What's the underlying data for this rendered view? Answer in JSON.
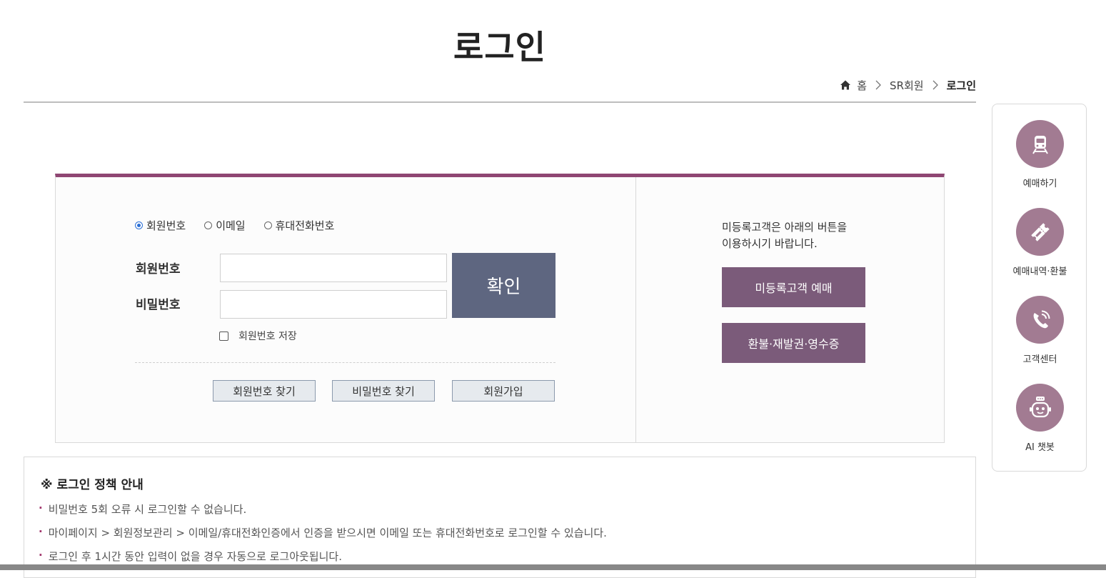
{
  "page": {
    "title": "로그인"
  },
  "breadcrumb": {
    "home": "홈",
    "parent": "SR회원",
    "current": "로그인"
  },
  "login": {
    "options": [
      {
        "label": "회원번호",
        "checked": true
      },
      {
        "label": "이메일",
        "checked": false
      },
      {
        "label": "휴대전화번호",
        "checked": false
      }
    ],
    "id_label": "회원번호",
    "pw_label": "비밀번호",
    "id_value": "",
    "pw_value": "",
    "confirm_label": "확인",
    "save_label": "회원번호 저장",
    "save_checked": false,
    "find_id_label": "회원번호 찾기",
    "find_pw_label": "비밀번호 찾기",
    "signup_label": "회원가입"
  },
  "guest": {
    "text_line1": "미등록고객은 아래의 버튼을",
    "text_line2": "이용하시기 바랍니다.",
    "book_label": "미등록고객 예매",
    "refund_label": "환불·재발권·영수증"
  },
  "policy": {
    "title": "※ 로그인 정책 안내",
    "items": [
      "비밀번호 5회 오류 시 로그인할 수 없습니다.",
      "마이페이지 > 회원정보관리 > 이메일/휴대전화인증에서 인증을 받으시면 이메일 또는 휴대전화번호로 로그인할 수 있습니다.",
      "로그인 후 1시간 동안 입력이 없을 경우 자동으로 로그아웃됩니다."
    ],
    "bullet": "·"
  },
  "quick_menu": [
    {
      "label": "예매하기",
      "icon": "train-icon"
    },
    {
      "label": "예매내역·환불",
      "icon": "ticket-icon"
    },
    {
      "label": "고객센터",
      "icon": "phone-icon"
    },
    {
      "label": "AI 챗봇",
      "icon": "robot-icon"
    }
  ],
  "colors": {
    "accent_border": "#8f4673",
    "confirm_button": "#5e6680",
    "guest_button": "#7b5b7a",
    "quick_icon_bg": "#a27b92",
    "bullet": "#a0346a"
  }
}
